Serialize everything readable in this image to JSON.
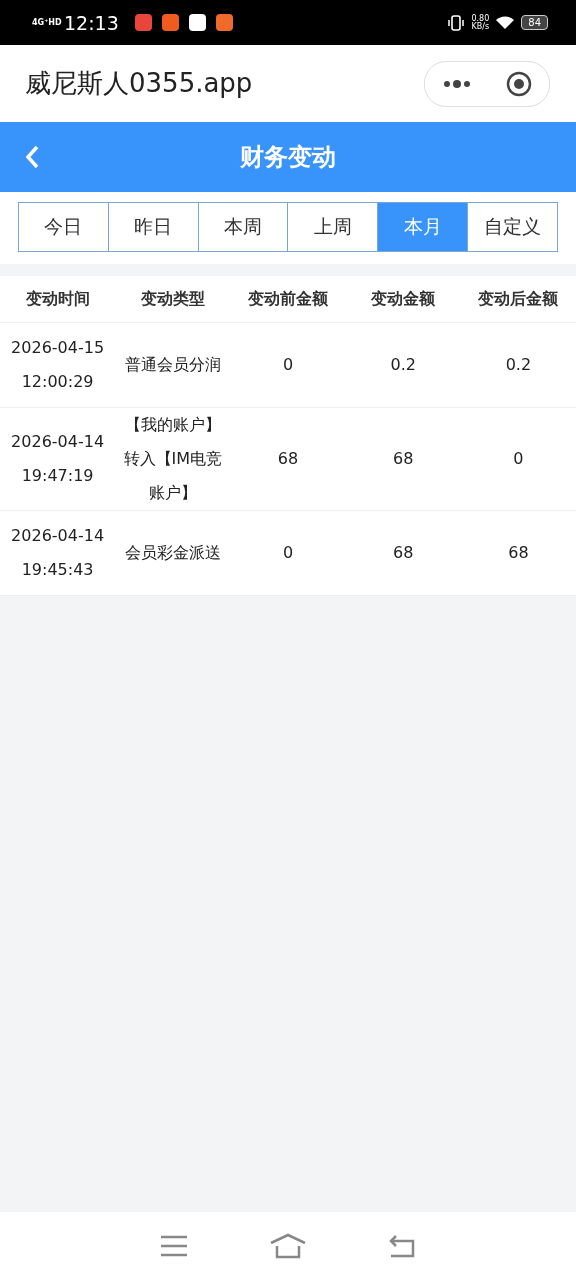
{
  "status_bar": {
    "network": "4G⁺HD",
    "time": "12:13",
    "speed_value": "0.80",
    "speed_unit": "KB/s",
    "battery": "84"
  },
  "mini_bar": {
    "title": "威尼斯人0355.app"
  },
  "header": {
    "title": "财务变动"
  },
  "tabs": [
    {
      "label": "今日",
      "selected": false
    },
    {
      "label": "昨日",
      "selected": false
    },
    {
      "label": "本周",
      "selected": false
    },
    {
      "label": "上周",
      "selected": false
    },
    {
      "label": "本月",
      "selected": true
    },
    {
      "label": "自定义",
      "selected": false
    }
  ],
  "table": {
    "columns": [
      "变动时间",
      "变动类型",
      "变动前金额",
      "变动金额",
      "变动后金额"
    ],
    "rows": [
      {
        "date": "2026-04-15",
        "time": "12:00:29",
        "type": "普通会员分润",
        "before": "0",
        "amount": "0.2",
        "after": "0.2"
      },
      {
        "date": "2026-04-14",
        "time": "19:47:19",
        "type": "【我的账户】转入【IM电竞账户】",
        "before": "68",
        "amount": "68",
        "after": "0"
      },
      {
        "date": "2026-04-14",
        "time": "19:45:43",
        "type": "会员彩金派送",
        "before": "0",
        "amount": "68",
        "after": "68"
      }
    ]
  }
}
